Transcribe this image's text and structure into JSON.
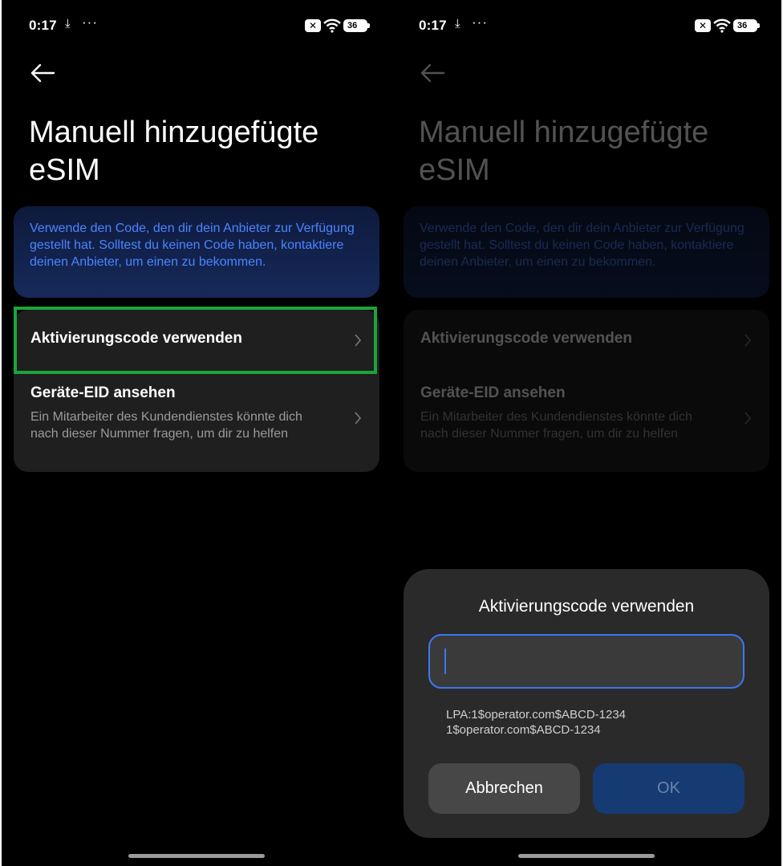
{
  "status_bar": {
    "time": "0:17",
    "download_icon": "download-icon",
    "more_icon": "more-icon",
    "sim_icon": "sim-x-icon",
    "wifi_icon": "wifi-icon",
    "battery_level": "36"
  },
  "page": {
    "back_icon": "back-arrow-icon",
    "title": "Manuell hinzugefügte eSIM",
    "info_text": "Verwende den Code, den dir dein Anbieter zur Verfügung gestellt hat. Solltest du keinen Code haben, kontaktiere deinen Anbieter, um einen zu bekommen.",
    "items": [
      {
        "label": "Aktivierungscode verwenden",
        "subtitle": ""
      },
      {
        "label": "Geräte-EID ansehen",
        "subtitle": "Ein Mitarbeiter des Kundendienstes könnte dich nach dieser Nummer fragen, um dir zu helfen"
      }
    ]
  },
  "dialog": {
    "title": "Aktivierungscode verwenden",
    "input_value": "",
    "hint_line1": "LPA:1$operator.com$ABCD-1234",
    "hint_line2": "1$operator.com$ABCD-1234",
    "cancel_label": "Abbrechen",
    "ok_label": "OK"
  },
  "colors": {
    "highlight": "#1aa53a",
    "accent_blue": "#3a78f2",
    "info_text": "#4b84ff"
  }
}
